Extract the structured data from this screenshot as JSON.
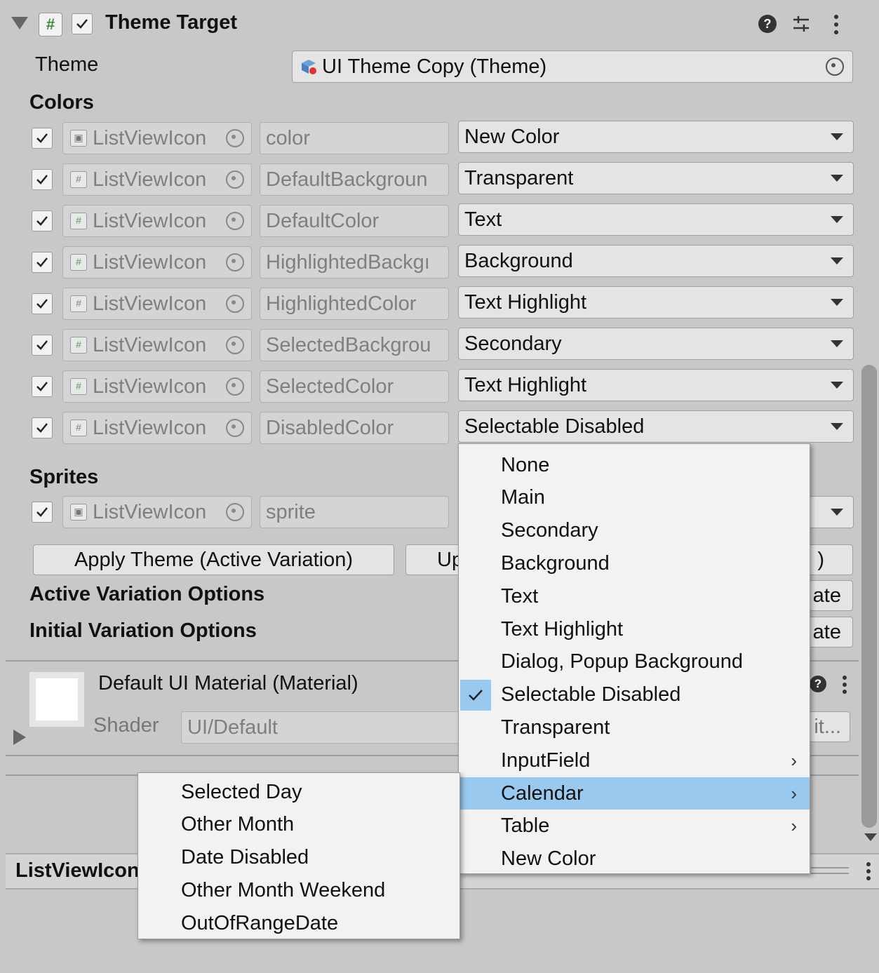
{
  "component": {
    "title": "Theme Target",
    "theme_label": "Theme",
    "theme_value": "UI Theme Copy (Theme)"
  },
  "colors": {
    "heading": "Colors",
    "rows": [
      {
        "target": "ListViewIcon",
        "property": "color",
        "value": "New Color"
      },
      {
        "target": "ListViewIcon",
        "property": "DefaultBackgroun",
        "value": "Transparent"
      },
      {
        "target": "ListViewIcon",
        "property": "DefaultColor",
        "value": "Text"
      },
      {
        "target": "ListViewIcon",
        "property": "HighlightedBackgı",
        "value": "Background"
      },
      {
        "target": "ListViewIcon",
        "property": "HighlightedColor",
        "value": "Text Highlight"
      },
      {
        "target": "ListViewIcon",
        "property": "SelectedBackgrou",
        "value": "Secondary"
      },
      {
        "target": "ListViewIcon",
        "property": "SelectedColor",
        "value": "Text Highlight"
      },
      {
        "target": "ListViewIcon",
        "property": "DisabledColor",
        "value": "Selectable Disabled"
      }
    ]
  },
  "sprites": {
    "heading": "Sprites",
    "rows": [
      {
        "target": "ListViewIcon",
        "property": "sprite"
      }
    ]
  },
  "buttons": {
    "apply_active": "Apply Theme (Active Variation)",
    "update_partial": "Up",
    "right_partial": ")",
    "active_update_partial": "ate",
    "initial_update_partial": "ate"
  },
  "options": {
    "active": "Active Variation Options",
    "initial": "Initial Variation Options"
  },
  "material": {
    "name": "Default UI Material (Material)",
    "shader_label": "Shader",
    "shader_value": "UI/Default",
    "edit_partial": "it..."
  },
  "bottom": {
    "object_name": "ListViewIcon"
  },
  "color_menu": {
    "items": [
      {
        "label": "None"
      },
      {
        "label": "Main"
      },
      {
        "label": "Secondary"
      },
      {
        "label": "Background"
      },
      {
        "label": "Text"
      },
      {
        "label": "Text Highlight"
      },
      {
        "label": "Dialog, Popup Background"
      },
      {
        "label": "Selectable Disabled",
        "checked": true
      },
      {
        "label": "Transparent"
      },
      {
        "label": "InputField",
        "submenu": true
      },
      {
        "label": "Calendar",
        "submenu": true,
        "highlighted": true
      },
      {
        "label": "Table",
        "submenu": true
      },
      {
        "label": "New Color"
      }
    ]
  },
  "calendar_submenu": {
    "items": [
      "Selected Day",
      "Other Month",
      "Date Disabled",
      "Other Month Weekend",
      "OutOfRangeDate"
    ]
  },
  "palette": {
    "highlight": "#99c9ef",
    "panel": "#c8c8c8",
    "menu": "#f2f2f2"
  }
}
